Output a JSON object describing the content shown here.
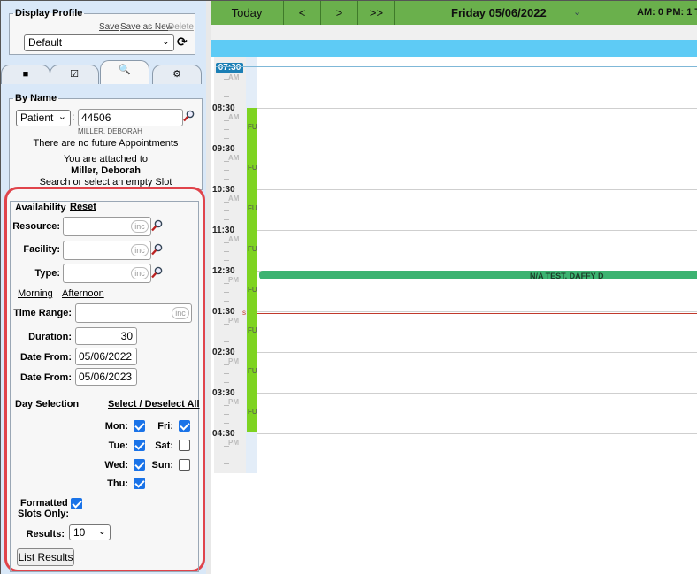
{
  "left": {
    "display_profile": {
      "legend": "Display Profile",
      "save": "Save",
      "save_as_new": "Save as New",
      "delete": "Delete",
      "selected": "Default"
    },
    "by_name": {
      "legend": "By Name",
      "type_selected": "Patient",
      "colon": ":",
      "id_value": "44506",
      "patient_name_small": "MILLER, DEBORAH",
      "msg1": "There are no future Appointments",
      "msg2": "You are attached to",
      "msg3": "Miller, Deborah",
      "msg4": "Search or select an empty Slot"
    },
    "availability": {
      "legend": "Availability",
      "reset": "Reset",
      "resource_label": "Resource:",
      "facility_label": "Facility:",
      "type_label": "Type:",
      "inc": "inc",
      "morning": "Morning",
      "afternoon": "Afternoon",
      "time_range_label": "Time Range:",
      "duration_label": "Duration:",
      "duration_value": "30",
      "date_from_label": "Date From:",
      "date_from_value": "05/06/2022",
      "date_to_label": "Date From:",
      "date_to_value": "05/06/2023",
      "day_selection": "Day Selection",
      "select_deselect": "Select / Deselect All",
      "days": {
        "mon": "Mon:",
        "tue": "Tue:",
        "wed": "Wed:",
        "thu": "Thu:",
        "fri": "Fri:",
        "sat": "Sat:",
        "sun": "Sun:"
      },
      "formatted_slots_1": "Formatted",
      "formatted_slots_2": "Slots Only:",
      "results_label": "Results:",
      "results_value": "10",
      "list_results": "List Results"
    }
  },
  "topbar": {
    "today": "Today",
    "prev": "<",
    "next": ">",
    "fast_next": ">>",
    "date": "Friday 05/06/2022",
    "am_pm": "AM: 0 PM: 1 T"
  },
  "calendar": {
    "current_time_label": "07:30",
    "times": [
      "08:30",
      "09:30",
      "10:30",
      "11:30",
      "12:30",
      "01:30",
      "02:30",
      "03:30",
      "04:30"
    ],
    "ampm": [
      "AM",
      "AM",
      "AM",
      "AM",
      "AM",
      "PM",
      "PM",
      "PM",
      "PM",
      "PM"
    ],
    "fu": "FU",
    "appointment": "N/A TEST, DAFFY D",
    "marker": "s"
  },
  "colors": {
    "highlight_ring": "#e0444b",
    "topbar_green": "#6ab04c",
    "slot_green": "#7ed321",
    "appointment_green": "#3cb371",
    "blue_band": "#5ecbf5",
    "now_line": "#c0392b"
  }
}
